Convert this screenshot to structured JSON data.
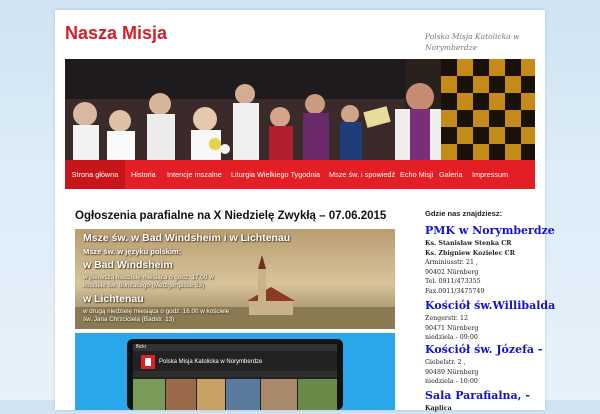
{
  "site": {
    "title": "Nasza Misja",
    "tagline": "Polska Misja Katolicka w Norymberdze"
  },
  "nav": {
    "items": [
      {
        "label": "Strona główna",
        "active": true
      },
      {
        "label": "Historia",
        "active": false
      },
      {
        "label": "Intencje mszalne",
        "active": false
      },
      {
        "label": "Liturgia Wielkiego Tygodnia",
        "active": false
      },
      {
        "label": "Msze św. i spowiedź",
        "active": false
      },
      {
        "label": "Echo Misji",
        "active": false
      },
      {
        "label": "Galeria",
        "active": false
      },
      {
        "label": "Impressum",
        "active": false
      }
    ]
  },
  "post": {
    "title": "Ogłoszenia parafialne na X Niedzielę Zwykłą – 07.06.2015",
    "image1": {
      "heading": "Msze św. w Bad Windsheim i w Lichtenau",
      "subheading": "Msze św. w języku polskim:",
      "place1": "w Bad Windsheim",
      "place1_line1": "w pierwszą niedzielę miesiąca o godz. 17.00 w",
      "place1_line2": "kościele św. Bonifacego (Metzgergasse 53)",
      "place2": "w Lichtenau",
      "place2_line1": "w drugą niedzielę miesiąca o godz. 16.00 w kościele",
      "place2_line2": "św. Jana Chrzciciela  (Badstr. 13)"
    },
    "image2": {
      "brand": "flickr",
      "header": "Polska Misja Katolicka w Norymberdze"
    }
  },
  "sidebar": {
    "heading": "Gdzie nas znajdziesz:",
    "blocks": [
      {
        "title": "PMK w Norymberdze",
        "lines": [
          {
            "text": "Ks. Stanisław Stenka CR",
            "bold": true
          },
          {
            "text": "Ks. Zbigniew Kozielec CR",
            "bold": true
          },
          {
            "text": "Arminiusstr. 21 ,",
            "bold": false
          },
          {
            "text": "90402 Nürnberg",
            "bold": false
          },
          {
            "text": "Tel. 0911/473355",
            "bold": false
          },
          {
            "text": "Fax.0911/3475749",
            "bold": false
          }
        ]
      },
      {
        "title": "Kościół św.Willibalda",
        "lines": [
          {
            "text": "Zengerstr. 12",
            "bold": false
          },
          {
            "text": "90471 Nürnberg",
            "bold": false
          },
          {
            "text": "niedziela - 09:00",
            "bold": false
          }
        ]
      },
      {
        "title": "Kościół św. Józefa -",
        "lines": [
          {
            "text": "Giebelstr. 2 ,",
            "bold": false
          },
          {
            "text": "90489 Nürnberg",
            "bold": false
          },
          {
            "text": "niedziela - 10:00",
            "bold": false
          }
        ]
      },
      {
        "title": "Sala Parafialna, -",
        "lines": [
          {
            "text": "Kaplica",
            "bold": true
          }
        ]
      }
    ]
  },
  "colors": {
    "accent": "#e31e24",
    "title": "#d4202a",
    "sidebar_link": "#1212c8"
  }
}
